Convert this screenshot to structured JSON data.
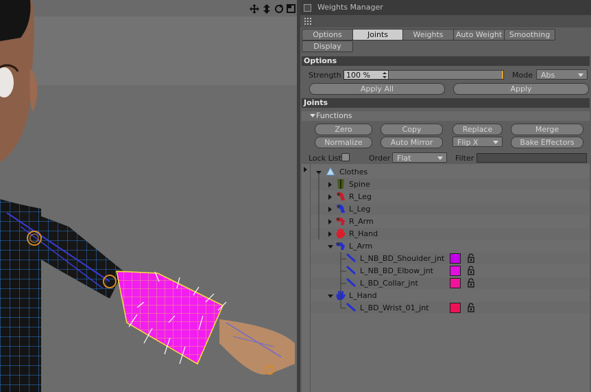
{
  "viewport": {
    "tools": [
      "move-icon",
      "arrows-updown-icon",
      "rotate-icon",
      "maximize-icon"
    ]
  },
  "panel": {
    "title": "Weights Manager",
    "tabs": [
      {
        "label": "Options",
        "active": false
      },
      {
        "label": "Joints",
        "active": true
      },
      {
        "label": "Weights",
        "active": false
      },
      {
        "label": "Auto Weight",
        "active": false
      },
      {
        "label": "Smoothing",
        "active": false
      },
      {
        "label": "Display",
        "active": false
      }
    ],
    "options": {
      "header": "Options",
      "strength_label": "Strength",
      "strength_value": "100 %",
      "strength_level": 1.0,
      "mode_label": "Mode",
      "mode_value": "Abs",
      "apply_all": "Apply All",
      "apply": "Apply"
    },
    "joints": {
      "header": "Joints",
      "functions_label": "Functions",
      "buttons_row1": [
        "Zero",
        "Copy",
        "Replace",
        "Merge"
      ],
      "buttons_row2_a": "Normalize",
      "buttons_row2_b": "Auto Mirror",
      "flip_value": "Flip X",
      "bake": "Bake Effectors",
      "lock_list_label": "Lock List",
      "order_label": "Order",
      "order_value": "Flat",
      "filter_label": "Filter",
      "filter_value": ""
    },
    "tree": [
      {
        "label": "Clothes",
        "level": 0,
        "expanded": true,
        "icon": "cloth-icon"
      },
      {
        "label": "Spine",
        "level": 1,
        "expanded": false,
        "icon": "spine-icon"
      },
      {
        "label": "R_Leg",
        "level": 1,
        "expanded": false,
        "icon": "leg-icon"
      },
      {
        "label": "L_Leg",
        "level": 1,
        "expanded": false,
        "icon": "leg-icon"
      },
      {
        "label": "R_Arm",
        "level": 1,
        "expanded": false,
        "icon": "arm-icon"
      },
      {
        "label": "R_Hand",
        "level": 1,
        "expanded": false,
        "icon": "hand-icon"
      },
      {
        "label": "L_Arm",
        "level": 1,
        "expanded": true,
        "icon": "arm-icon"
      },
      {
        "label": "L_NB_BD_Shoulder_jnt",
        "level": 2,
        "icon": "joint-icon",
        "color": "#c400e8"
      },
      {
        "label": "L_NB_BD_Elbow_jnt",
        "level": 2,
        "icon": "joint-icon",
        "color": "#e10fe0"
      },
      {
        "label": "L_BD_Collar_jnt",
        "level": 2,
        "icon": "joint-icon",
        "color": "#f0149a"
      },
      {
        "label": "L_Hand",
        "level": 1,
        "expanded": true,
        "icon": "hand-icon"
      },
      {
        "label": "L_BD_Wrist_01_jnt",
        "level": 2,
        "icon": "joint-icon",
        "color": "#f01058"
      }
    ]
  }
}
